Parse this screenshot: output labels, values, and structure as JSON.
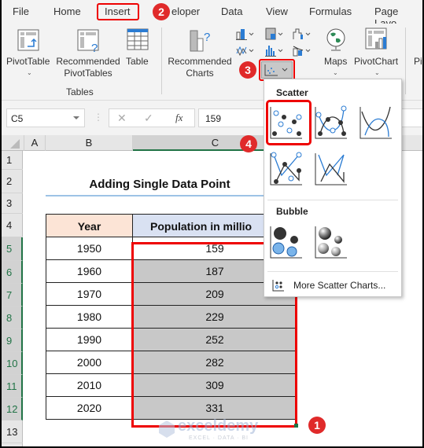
{
  "tabs": [
    "File",
    "Home",
    "Insert",
    "eloper",
    "Data",
    "View",
    "Formulas",
    "Page Layo"
  ],
  "ribbon": {
    "pivot_table": "PivotTable",
    "recommended_pivot": [
      "Recommended",
      "PivotTables"
    ],
    "table": "Table",
    "tables_group": "Tables",
    "recommended_charts": [
      "Recommended",
      "Charts"
    ],
    "maps": "Maps",
    "pivot_chart": "PivotChart",
    "pi_partial": "Pi"
  },
  "formula_bar": {
    "name_box": "C5",
    "fx": "fx",
    "value": "159"
  },
  "columns": [
    "A",
    "B",
    "C"
  ],
  "rows": [
    "1",
    "2",
    "3",
    "4",
    "5",
    "6",
    "7",
    "8",
    "9",
    "10",
    "11",
    "12",
    "13"
  ],
  "sheet": {
    "title": "Adding Single Data Point",
    "headers": [
      "Year",
      "Population in millio"
    ],
    "data": [
      [
        "1950",
        "159"
      ],
      [
        "1960",
        "187"
      ],
      [
        "1970",
        "209"
      ],
      [
        "1980",
        "229"
      ],
      [
        "1990",
        "252"
      ],
      [
        "2000",
        "282"
      ],
      [
        "2010",
        "309"
      ],
      [
        "2020",
        "331"
      ]
    ]
  },
  "dropdown": {
    "scatter_heading": "Scatter",
    "bubble_heading": "Bubble",
    "more_link": "More Scatter Charts..."
  },
  "badges": [
    "1",
    "2",
    "3",
    "4"
  ],
  "watermark": {
    "name": "exceldemy",
    "tag": "EXCEL · DATA · BI"
  },
  "colors": {
    "accent_red": "#e00000",
    "excel_green": "#217346",
    "header_peach": "#fce4d6",
    "header_blue": "#d9e1f2",
    "selection_gray": "#c8c8c8"
  }
}
